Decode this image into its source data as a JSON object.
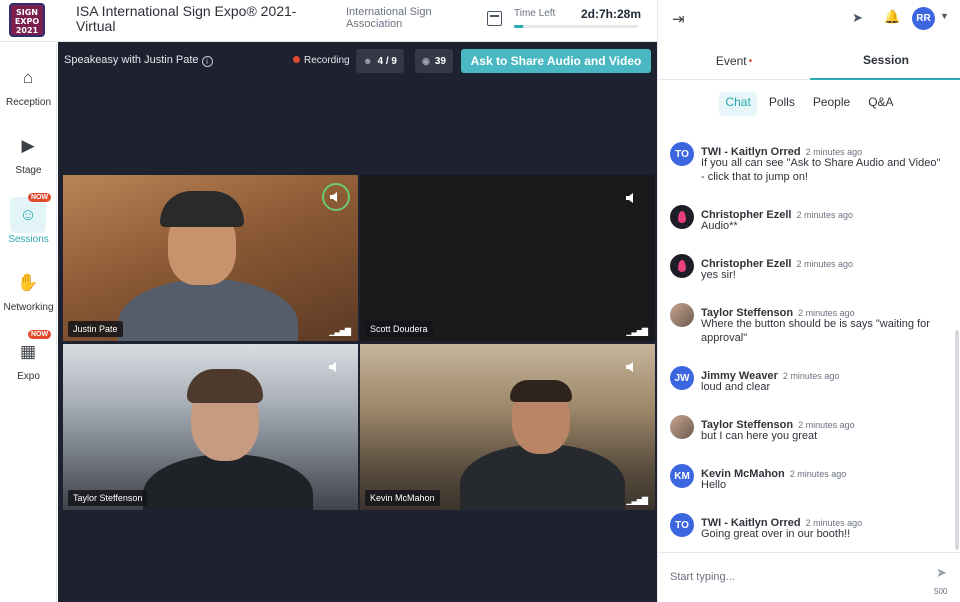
{
  "header": {
    "logo_text": "ISA SIGN EXPO 2021",
    "event_title": "ISA International Sign Expo® 2021-Virtual",
    "org_name": "International Sign Association",
    "time_left_label": "Time Left",
    "time_left_value": "2d:7h:28m",
    "time_progress_fraction": 0.07,
    "calendar_icon": "calendar-icon"
  },
  "nav": {
    "items": [
      {
        "label": "Reception",
        "icon": "home-icon",
        "glyph": "⌂",
        "badge": ""
      },
      {
        "label": "Stage",
        "icon": "video-camera-icon",
        "glyph": "▶",
        "badge": ""
      },
      {
        "label": "Sessions",
        "icon": "people-icon",
        "glyph": "☺",
        "badge": "NOW"
      },
      {
        "label": "Networking",
        "icon": "handshake-icon",
        "glyph": "✋",
        "badge": ""
      },
      {
        "label": "Expo",
        "icon": "booth-icon",
        "glyph": "▦",
        "badge": "NOW"
      }
    ]
  },
  "stage": {
    "session_name": "Speakeasy with Justin Pate",
    "info_icon": "i",
    "recording_label": "Recording",
    "participants": "4 / 9",
    "viewers": "39",
    "share_button": "Ask to Share Audio and Video",
    "tiles": [
      {
        "name": "Justin Pate",
        "speaking": true
      },
      {
        "name": "Scott Doudera",
        "speaking": false
      },
      {
        "name": "Taylor Steffenson",
        "speaking": false
      },
      {
        "name": "Kevin McMahon",
        "speaking": false
      }
    ],
    "signal_glyph": "▁▃▅▇"
  },
  "right": {
    "avatar_initials": "RR",
    "tabs": {
      "event": "Event",
      "session": "Session"
    },
    "sub_tabs": [
      "Chat",
      "Polls",
      "People",
      "Q&A"
    ],
    "messages": [
      {
        "initials": "TO",
        "avatar": "blue",
        "name": "TWI - Kaitlyn Orred",
        "time": "2 minutes ago",
        "text": "If you all can see \"Ask to Share Audio and Video\" - click that to jump on!"
      },
      {
        "initials": "",
        "avatar": "flame",
        "name": "Christopher Ezell",
        "time": "2 minutes ago",
        "text": "Audio**"
      },
      {
        "initials": "",
        "avatar": "flame",
        "name": "Christopher Ezell",
        "time": "2 minutes ago",
        "text": "yes sir!"
      },
      {
        "initials": "",
        "avatar": "photo",
        "name": "Taylor Steffenson",
        "time": "2 minutes ago",
        "text": "Where the button should be is says \"waiting for approval\""
      },
      {
        "initials": "JW",
        "avatar": "blue",
        "name": "Jimmy Weaver",
        "time": "2 minutes ago",
        "text": "loud and clear"
      },
      {
        "initials": "",
        "avatar": "photo",
        "name": "Taylor Steffenson",
        "time": "2 minutes ago",
        "text": "but I can here you great"
      },
      {
        "initials": "KM",
        "avatar": "blue",
        "name": "Kevin McMahon",
        "time": "2 minutes ago",
        "text": "Hello"
      },
      {
        "initials": "TO",
        "avatar": "blue",
        "name": "TWI - Kaitlyn Orred",
        "time": "2 minutes ago",
        "text": "Going great over in our booth!!"
      }
    ],
    "composer_placeholder": "Start typing...",
    "char_count": "500"
  }
}
